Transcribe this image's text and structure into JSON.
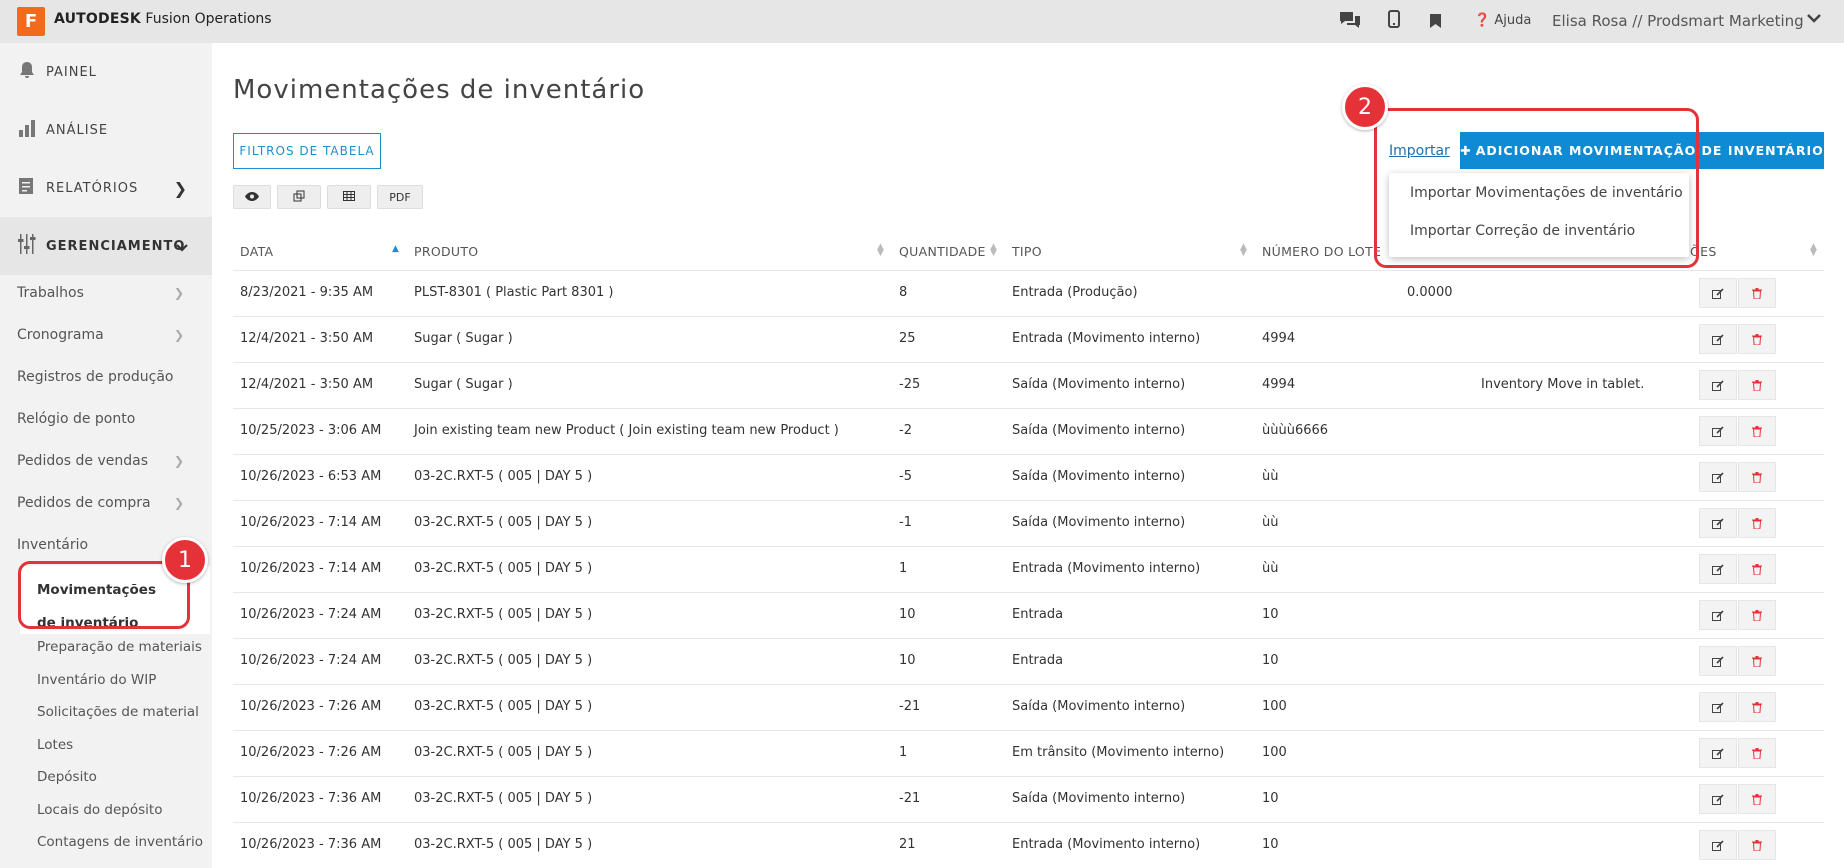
{
  "topbar": {
    "logo_letter": "F",
    "brand_bold": "AUTODESK",
    "brand_rest": " Fusion Operations",
    "help": "Ajuda",
    "user": "Elisa Rosa // Prodsmart Marketing",
    "icons": [
      "chat-icon",
      "mobile-icon",
      "bookmark-icon",
      "help-icon",
      "chevron-down-icon"
    ]
  },
  "sidebar": {
    "main": [
      {
        "label": "PAINEL",
        "icon": "bell-icon"
      },
      {
        "label": "ANÁLISE",
        "icon": "bar-chart-icon"
      },
      {
        "label": "RELATÓRIOS",
        "icon": "report-icon"
      },
      {
        "label": "GERENCIAMENTO",
        "icon": "sliders-icon"
      }
    ],
    "sub": [
      "Trabalhos",
      "Cronograma",
      "Registros de produção",
      "Relógio de ponto",
      "Pedidos de vendas",
      "Pedidos de compra",
      "Inventário"
    ],
    "inventory_active": "Movimentações de inventário",
    "inventory_sub": [
      "Preparação de materiais",
      "Inventário do WIP",
      "Solicitações de material",
      "Lotes",
      "Depósito",
      "Locais do depósito",
      "Contagens de inventário"
    ]
  },
  "main": {
    "title": "Movimentações de inventário",
    "filter_button": "FILTROS DE TABELA",
    "tool_pdf": "PDF",
    "import_link": "Importar",
    "add_button": "ADICIONAR MOVIMENTAÇÃO DE INVENTÁRIO",
    "dropdown": [
      "Importar Movimentações de inventário",
      "Importar Correção de inventário"
    ]
  },
  "callouts": [
    "1",
    "2"
  ],
  "table": {
    "headers": [
      "DATA",
      "PRODUTO",
      "QUANTIDADE",
      "TIPO",
      "NÚMERO DO LOTE",
      "ÕES"
    ],
    "rows": [
      [
        "8/23/2021 - 9:35 AM",
        "PLST-8301 ( Plastic Part 8301 )",
        "8",
        "Entrada (Produção)",
        "",
        "0.0000",
        ""
      ],
      [
        "12/4/2021 - 3:50 AM",
        "Sugar ( Sugar )",
        "25",
        "Entrada (Movimento interno)",
        "4994",
        "",
        ""
      ],
      [
        "12/4/2021 - 3:50 AM",
        "Sugar ( Sugar )",
        "-25",
        "Saída (Movimento interno)",
        "4994",
        "",
        "Inventory Move in tablet."
      ],
      [
        "10/25/2023 - 3:06 AM",
        "Join existing team new Product ( Join existing team new Product )",
        "-2",
        "Saída (Movimento interno)",
        "ùùùù6666",
        "",
        ""
      ],
      [
        "10/26/2023 - 6:53 AM",
        "03-2C.RXT-5 ( 005 | DAY 5 )",
        "-5",
        "Saída (Movimento interno)",
        "ùù",
        "",
        ""
      ],
      [
        "10/26/2023 - 7:14 AM",
        "03-2C.RXT-5 ( 005 | DAY 5 )",
        "-1",
        "Saída (Movimento interno)",
        "ùù",
        "",
        ""
      ],
      [
        "10/26/2023 - 7:14 AM",
        "03-2C.RXT-5 ( 005 | DAY 5 )",
        "1",
        "Entrada (Movimento interno)",
        "ùù",
        "",
        ""
      ],
      [
        "10/26/2023 - 7:24 AM",
        "03-2C.RXT-5 ( 005 | DAY 5 )",
        "10",
        "Entrada",
        "10",
        "",
        ""
      ],
      [
        "10/26/2023 - 7:24 AM",
        "03-2C.RXT-5 ( 005 | DAY 5 )",
        "10",
        "Entrada",
        "10",
        "",
        ""
      ],
      [
        "10/26/2023 - 7:26 AM",
        "03-2C.RXT-5 ( 005 | DAY 5 )",
        "-21",
        "Saída (Movimento interno)",
        "100",
        "",
        ""
      ],
      [
        "10/26/2023 - 7:26 AM",
        "03-2C.RXT-5 ( 005 | DAY 5 )",
        "1",
        "Em trânsito (Movimento interno)",
        "100",
        "",
        ""
      ],
      [
        "10/26/2023 - 7:36 AM",
        "03-2C.RXT-5 ( 005 | DAY 5 )",
        "-21",
        "Saída (Movimento interno)",
        "10",
        "",
        ""
      ],
      [
        "10/26/2023 - 7:36 AM",
        "03-2C.RXT-5 ( 005 | DAY 5 )",
        "21",
        "Entrada (Movimento interno)",
        "10",
        "",
        ""
      ]
    ]
  },
  "colors": {
    "accent": "#0e8bd3",
    "callout": "#e53238",
    "brand": "#f26b1d"
  }
}
